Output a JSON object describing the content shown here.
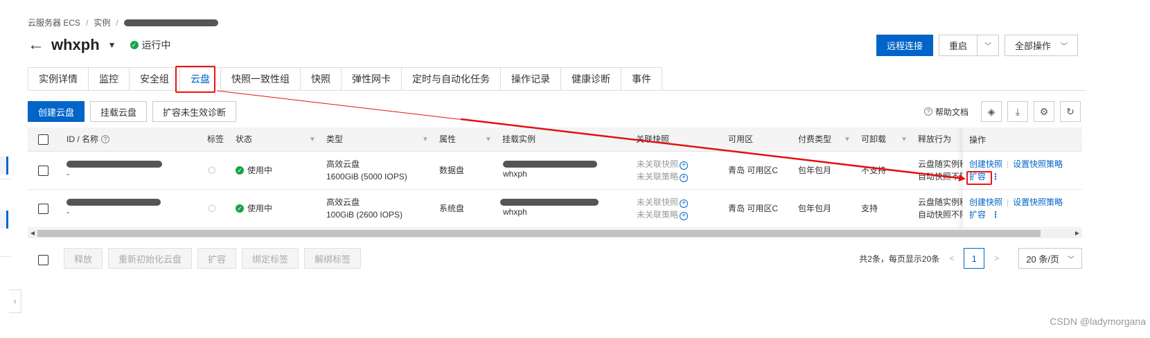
{
  "breadcrumb": {
    "items": [
      "云服务器 ECS",
      "实例"
    ]
  },
  "instance": {
    "name": "whxph",
    "status": "运行中"
  },
  "header_actions": {
    "remote": "远程连接",
    "restart": "重启",
    "all_ops": "全部操作"
  },
  "tabs": [
    "实例详情",
    "监控",
    "安全组",
    "云盘",
    "快照一致性组",
    "快照",
    "弹性网卡",
    "定时与自动化任务",
    "操作记录",
    "健康诊断",
    "事件"
  ],
  "active_tab": "云盘",
  "toolbar": {
    "create": "创建云盘",
    "attach": "挂载云盘",
    "diagnose": "扩容未生效诊断"
  },
  "tools": {
    "help": "帮助文档"
  },
  "table": {
    "headers": {
      "id": "ID / 名称",
      "tag": "标签",
      "status": "状态",
      "type": "类型",
      "attr": "属性",
      "instance": "挂载实例",
      "snapshot": "关联快照",
      "zone": "可用区",
      "billing": "付费类型",
      "detachable": "可卸载",
      "release": "释放行为",
      "ops": "操作"
    },
    "rows": [
      {
        "name": "-",
        "status": "使用中",
        "type": "高效云盘",
        "spec": "1600GiB (5000 IOPS)",
        "attr": "数据盘",
        "instance": "whxph",
        "snap1": "未关联快照",
        "snap2": "未关联策略",
        "zone": "青岛 可用区C",
        "billing": "包年包月",
        "detachable": "不支持",
        "release1": "云盘随实例释",
        "release2": "自动快照不随",
        "op1": "创建快照",
        "op2": "设置快照策略",
        "op3": "扩容"
      },
      {
        "name": "-",
        "status": "使用中",
        "type": "高效云盘",
        "spec": "100GiB (2600 IOPS)",
        "attr": "系统盘",
        "instance": "whxph",
        "snap1": "未关联快照",
        "snap2": "未关联策略",
        "zone": "青岛 可用区C",
        "billing": "包年包月",
        "detachable": "支持",
        "release1": "云盘随实例释",
        "release2": "自动快照不随",
        "op1": "创建快照",
        "op2": "设置快照策略",
        "op3": "扩容"
      }
    ]
  },
  "batch": [
    "释放",
    "重新初始化云盘",
    "扩容",
    "绑定标签",
    "解绑标签"
  ],
  "pagination": {
    "summary": "共2条，每页显示20条",
    "page": "1",
    "size": "20 条/页"
  },
  "watermark": "CSDN @ladymorgana",
  "colors": {
    "primary": "#0064c8",
    "annotation": "#e11111",
    "success": "#16a34a"
  }
}
